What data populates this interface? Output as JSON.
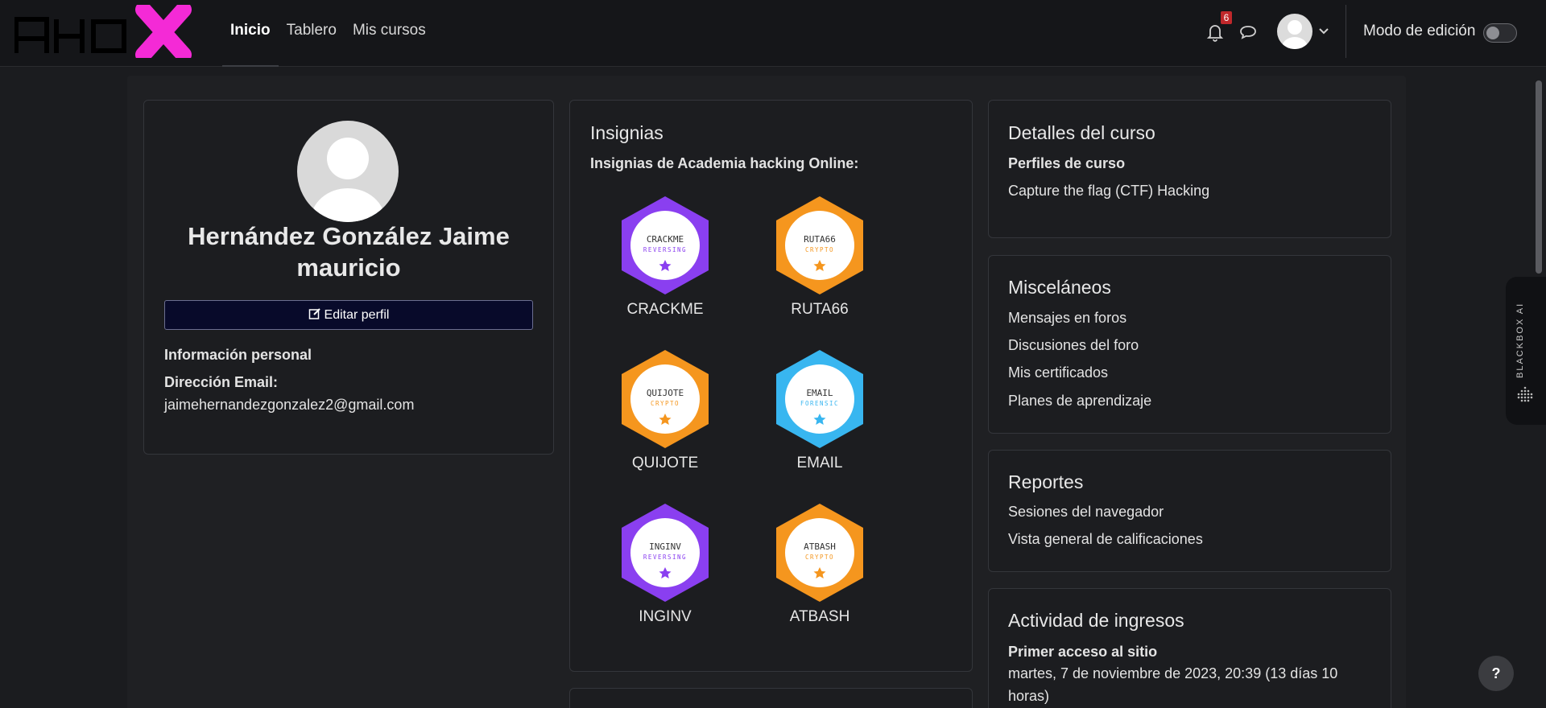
{
  "header": {
    "logo_text": "AHOX",
    "nav": [
      "Inicio",
      "Tablero",
      "Mis cursos"
    ],
    "notification_count": "6",
    "edit_mode_label": "Modo de edición"
  },
  "profile": {
    "name": "Hernández González Jaime mauricio",
    "edit_button": "Editar perfil",
    "section_title": "Información personal",
    "email_label": "Dirección Email:",
    "email": "jaimehernandezgonzalez2@gmail.com"
  },
  "badges": {
    "title": "Insignias",
    "subtitle": "Insignias de Academia hacking Online:",
    "items": [
      {
        "label": "CRACKME",
        "emblem": "CRACKME",
        "category": "REVERSING",
        "color": "#8a3ff0"
      },
      {
        "label": "RUTA66",
        "emblem": "RUTA66",
        "category": "CRYPTO",
        "color": "#f5961e"
      },
      {
        "label": "QUIJOTE",
        "emblem": "QUIJOTE",
        "category": "CRYPTO",
        "color": "#f5961e"
      },
      {
        "label": "EMAIL",
        "emblem": "EMAIL",
        "category": "FORENSIC",
        "color": "#38b6f0"
      },
      {
        "label": "INGINV",
        "emblem": "INGINV",
        "category": "REVERSING",
        "color": "#8a3ff0"
      },
      {
        "label": "ATBASH",
        "emblem": "ATBASH",
        "category": "CRYPTO",
        "color": "#f5961e"
      }
    ]
  },
  "course_details": {
    "title": "Detalles del curso",
    "subtitle": "Perfiles de curso",
    "course": "Capture the flag (CTF) Hacking"
  },
  "misc": {
    "title": "Misceláneos",
    "links": [
      "Mensajes en foros",
      "Discusiones del foro",
      "Mis certificados",
      "Planes de aprendizaje"
    ]
  },
  "reports": {
    "title": "Reportes",
    "links": [
      "Sesiones del navegador",
      "Vista general de calificaciones"
    ]
  },
  "login_activity": {
    "title": "Actividad de ingresos",
    "first_access_label": "Primer acceso al sitio",
    "first_access_value": "martes, 7 de noviembre de 2023, 20:39  (13 días 10 horas)"
  },
  "side_tab": {
    "label": "BLACKBOX AI"
  },
  "help_label": "?"
}
